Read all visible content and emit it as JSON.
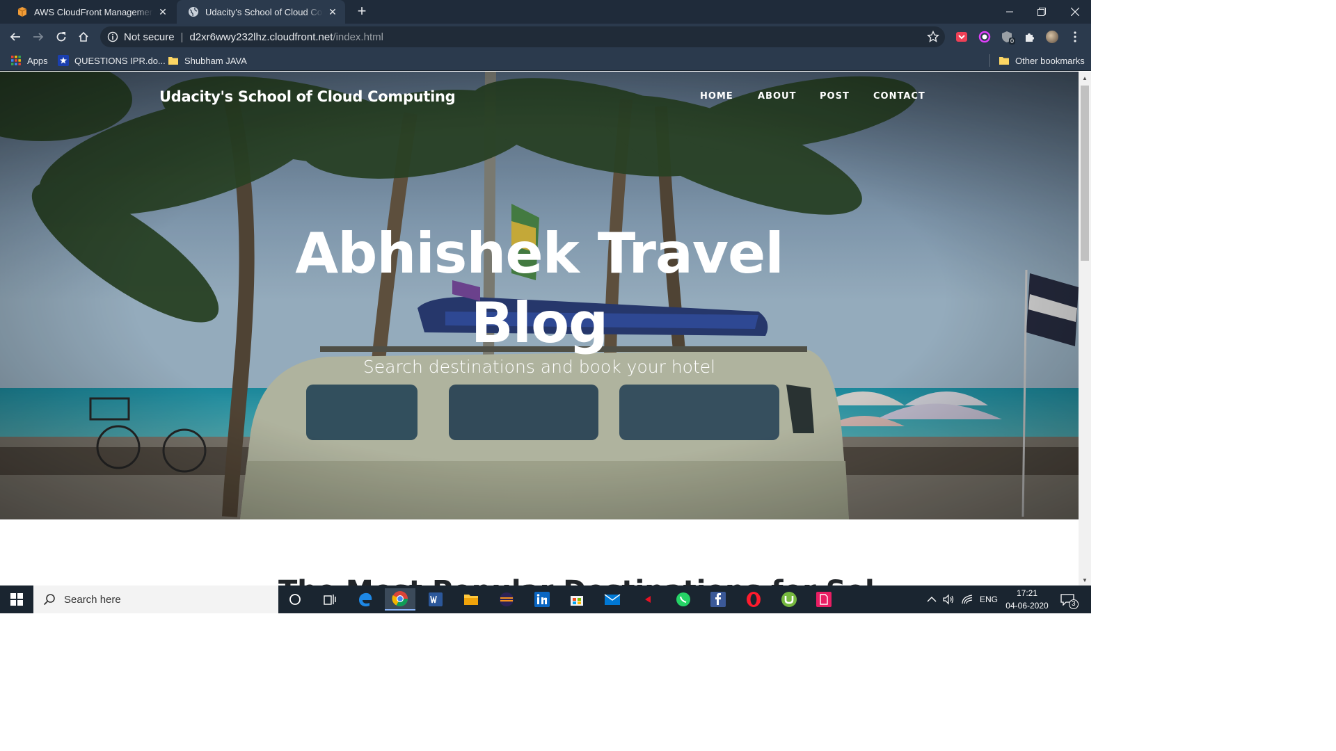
{
  "browser": {
    "tabs": [
      {
        "title": "AWS CloudFront Management C",
        "active": false
      },
      {
        "title": "Udacity's School of Cloud Compu",
        "active": true
      }
    ],
    "address": {
      "security": "Not secure",
      "host": "d2xr6wwy232lhz.cloudfront.net",
      "path": "/index.html"
    },
    "bookmarks": [
      {
        "label": "Apps",
        "icon": "apps-grid-icon"
      },
      {
        "label": "QUESTIONS IPR.do...",
        "icon": "star-bookmark-icon"
      },
      {
        "label": "Shubham JAVA",
        "icon": "folder-icon"
      }
    ],
    "other_bookmarks": "Other bookmarks"
  },
  "site": {
    "brand": "Udacity's School of Cloud Computing",
    "nav": [
      "HOME",
      "ABOUT",
      "POST",
      "CONTACT"
    ],
    "hero_title_line1": "Abhishek Travel",
    "hero_title_line2": "Blog",
    "hero_subtitle": "Search destinations and book your hotel",
    "section_heading": "The Most Popular Destinations for Sol..."
  },
  "taskbar": {
    "search_placeholder": "Search here",
    "language": "ENG",
    "time": "17:21",
    "date": "04-06-2020",
    "notification_count": "3",
    "extension_badge": "0"
  },
  "colors": {
    "tabstrip": "#1f2b3a",
    "toolbar": "#2b3a4d",
    "taskbar": "#1a2530"
  }
}
